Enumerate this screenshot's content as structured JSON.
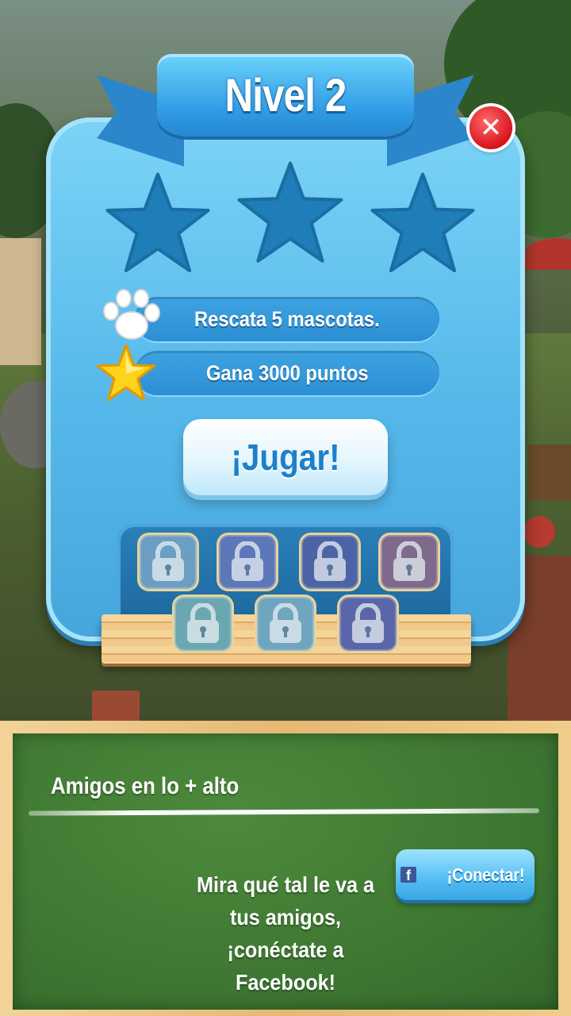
{
  "level": {
    "title": "Nivel 2"
  },
  "stars": {
    "earned": 0,
    "total": 3
  },
  "goals": [
    {
      "icon": "paw-icon",
      "text": "Rescata 5 mascotas."
    },
    {
      "icon": "gold-star-icon",
      "text": "Gana 3000 puntos"
    }
  ],
  "play_button": {
    "label": "¡Jugar!"
  },
  "boosters": [
    {
      "name": "booster-1",
      "locked": true
    },
    {
      "name": "booster-2",
      "locked": true
    },
    {
      "name": "booster-3",
      "locked": true
    },
    {
      "name": "booster-4",
      "locked": true
    },
    {
      "name": "booster-5",
      "locked": true
    },
    {
      "name": "booster-6",
      "locked": true
    },
    {
      "name": "booster-7",
      "locked": true
    }
  ],
  "friends_board": {
    "title": "Amigos en lo + alto",
    "message": "Mira qué tal le va a tus amigos, ¡conéctate a Facebook!",
    "connect_button": {
      "label": "¡Conectar!",
      "icon": "facebook-icon",
      "icon_text": "f"
    }
  },
  "colors": {
    "panel": "#55b8ea",
    "ribbon": "#2f9be4",
    "close": "#d8141c",
    "board": "#3b7430",
    "frame": "#e5b874"
  }
}
